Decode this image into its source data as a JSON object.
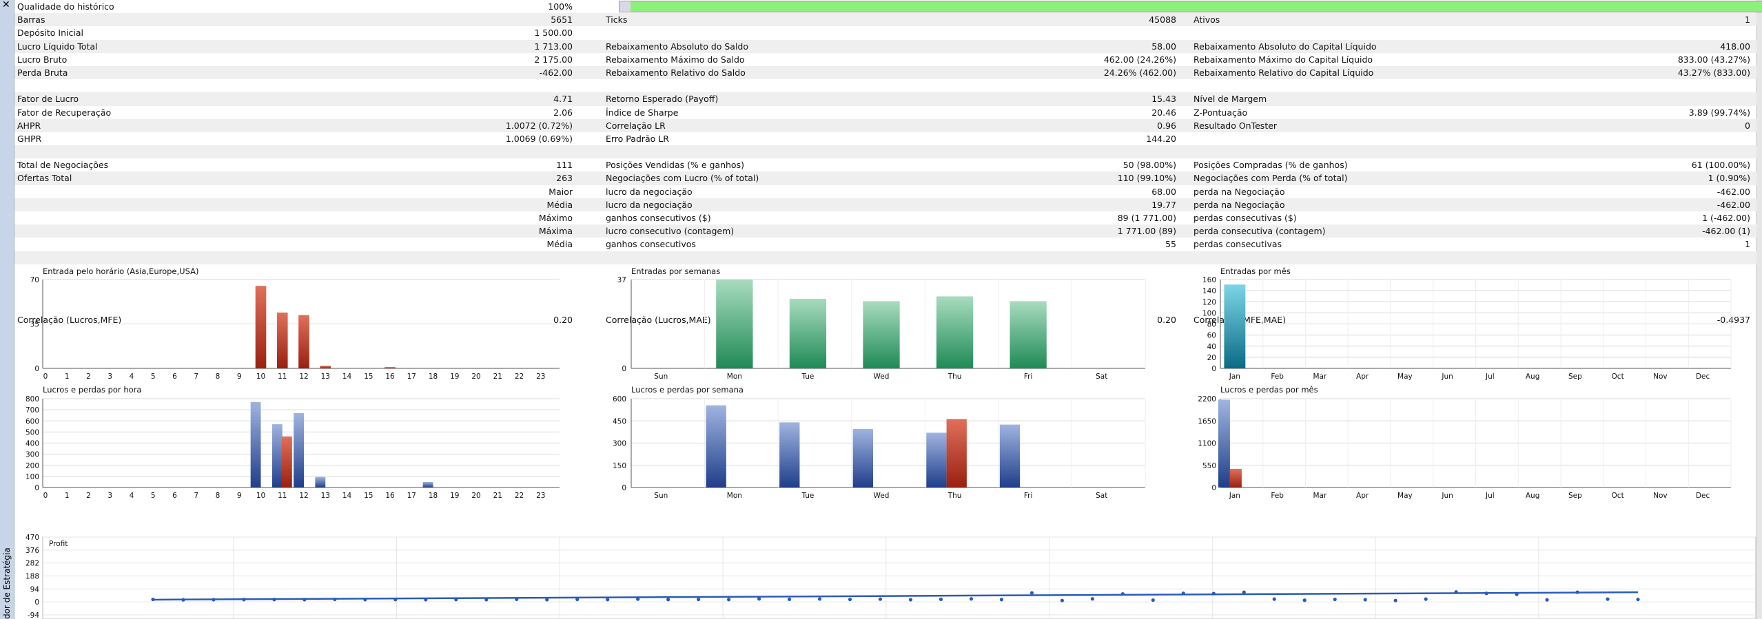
{
  "sidebar": {
    "close_glyph": "✕",
    "vertical_label": "dor de Estratégia"
  },
  "summary": {
    "quality_label": "Qualidade do histórico",
    "quality_value": "100%",
    "quality_fraction": 1.0,
    "rows": [
      {
        "shade": true,
        "c": [
          "Barras",
          "5651",
          "Ticks",
          "45088",
          "Ativos",
          "1"
        ]
      },
      {
        "shade": false,
        "c": [
          "Depósito Inicial",
          "1 500.00",
          "",
          "",
          "",
          ""
        ]
      },
      {
        "shade": true,
        "c": [
          "Lucro Líquido Total",
          "1 713.00",
          "Rebaixamento Absoluto do Saldo",
          "58.00",
          "Rebaixamento Absoluto do Capital Líquido",
          "418.00"
        ]
      },
      {
        "shade": false,
        "c": [
          "Lucro Bruto",
          "2 175.00",
          "Rebaixamento Máximo do Saldo",
          "462.00 (24.26%)",
          "Rebaixamento Máximo do Capital Líquido",
          "833.00 (43.27%)"
        ]
      },
      {
        "shade": true,
        "c": [
          "Perda Bruta",
          "-462.00",
          "Rebaixamento Relativo do Saldo",
          "24.26% (462.00)",
          "Rebaixamento Relativo do Capital Líquido",
          "43.27% (833.00)"
        ]
      },
      {
        "shade": false,
        "c": [
          "",
          "",
          "",
          "",
          "",
          ""
        ]
      },
      {
        "shade": true,
        "c": [
          "Fator de Lucro",
          "4.71",
          "Retorno Esperado (Payoff)",
          "15.43",
          "Nível de Margem",
          ""
        ]
      },
      {
        "shade": false,
        "c": [
          "Fator de Recuperação",
          "2.06",
          "Índice de Sharpe",
          "20.46",
          "Z-Pontuação",
          "3.89 (99.74%)"
        ]
      },
      {
        "shade": true,
        "c": [
          "AHPR",
          "1.0072 (0.72%)",
          "Correlação LR",
          "0.96",
          "Resultado OnTester",
          "0"
        ]
      },
      {
        "shade": false,
        "c": [
          "GHPR",
          "1.0069 (0.69%)",
          "Erro Padrão LR",
          "144.20",
          "",
          ""
        ]
      },
      {
        "shade": true,
        "c": [
          "",
          "",
          "",
          "",
          "",
          ""
        ]
      },
      {
        "shade": false,
        "c": [
          "Total de Negociações",
          "111",
          "Posições Vendidas (% e ganhos)",
          "50 (98.00%)",
          "Posições Compradas (% de ganhos)",
          "61 (100.00%)"
        ]
      },
      {
        "shade": true,
        "c": [
          "Ofertas Total",
          "263",
          "Negociações com Lucro (% of total)",
          "110 (99.10%)",
          "Negociações com Perda (% of total)",
          "1 (0.90%)"
        ]
      },
      {
        "shade": false,
        "r": "Maior",
        "c": [
          "",
          "",
          "lucro da negociação",
          "68.00",
          "perda na Negociação",
          "-462.00"
        ]
      },
      {
        "shade": true,
        "r": "Média",
        "c": [
          "",
          "",
          "lucro da negociação",
          "19.77",
          "perda na Negociação",
          "-462.00"
        ]
      },
      {
        "shade": false,
        "r": "Máximo",
        "c": [
          "",
          "",
          "ganhos consecutivos ($)",
          "89 (1 771.00)",
          "perdas consecutivas ($)",
          "1 (-462.00)"
        ]
      },
      {
        "shade": true,
        "r": "Máxima",
        "c": [
          "",
          "",
          "lucro consecutivo (contagem)",
          "1 771.00 (89)",
          "perda consecutiva (contagem)",
          "-462.00 (1)"
        ]
      },
      {
        "shade": false,
        "r": "Média",
        "c": [
          "",
          "",
          "ganhos consecutivos",
          "55",
          "perdas consecutivas",
          "1"
        ]
      },
      {
        "shade": true,
        "c": [
          "",
          "",
          "",
          "",
          "",
          ""
        ]
      }
    ]
  },
  "correlation_row": {
    "labels": [
      "Correlação (Lucros,MFE)",
      "Correlação (Lucros,MAE)",
      "Correlação(MFE,MAE)"
    ],
    "values": [
      "0.20",
      "0.20",
      "-0.4937"
    ]
  },
  "colors": {
    "red_bar_top": "#e0705a",
    "red_bar_bottom": "#9a2010",
    "green_bar_top": "#a8dcbf",
    "green_bar_bottom": "#1f8a55",
    "teal_bar_top": "#7cd6e6",
    "teal_bar_bottom": "#0a6a85",
    "blue_bar_top": "#a0b4e0",
    "blue_bar_bottom": "#1f3e8a",
    "line_blue": "#2a5bb8",
    "gridline": "#d8d8d8"
  },
  "chart_data": [
    {
      "type": "bar",
      "title": "Entrada pelo horário (Asia,Europe,USA)",
      "categories": [
        "0",
        "1",
        "2",
        "3",
        "4",
        "5",
        "6",
        "7",
        "8",
        "9",
        "10",
        "11",
        "12",
        "13",
        "14",
        "15",
        "16",
        "17",
        "18",
        "19",
        "20",
        "21",
        "22",
        "23"
      ],
      "yticks": [
        "0",
        "35",
        "70"
      ],
      "ylim": [
        0,
        70
      ],
      "series": [
        {
          "values": [
            0,
            0,
            0,
            0,
            0,
            0,
            0,
            0,
            0,
            0,
            65,
            44,
            42,
            2,
            0,
            0,
            1,
            0,
            0,
            0,
            0,
            0,
            0,
            0
          ]
        }
      ]
    },
    {
      "type": "bar",
      "title": "Entradas por semanas",
      "categories": [
        "Sun",
        "Mon",
        "Tue",
        "Wed",
        "Thu",
        "Fri",
        "Sat"
      ],
      "yticks": [
        "0",
        "37"
      ],
      "ylim": [
        0,
        37
      ],
      "series": [
        {
          "values": [
            0,
            37,
            29,
            28,
            30,
            28,
            0
          ]
        }
      ]
    },
    {
      "type": "bar",
      "title": "Entradas por mês",
      "categories": [
        "Jan",
        "Feb",
        "Mar",
        "Apr",
        "May",
        "Jun",
        "Jul",
        "Aug",
        "Sep",
        "Oct",
        "Nov",
        "Dec"
      ],
      "yticks": [
        "0",
        "20",
        "40",
        "60",
        "80",
        "100",
        "120",
        "140",
        "160"
      ],
      "ylim": [
        0,
        160
      ],
      "series": [
        {
          "values": [
            151,
            0,
            0,
            0,
            0,
            0,
            0,
            0,
            0,
            0,
            0,
            0
          ]
        }
      ]
    },
    {
      "type": "bar",
      "title": "Lucros e perdas por hora",
      "categories": [
        "0",
        "1",
        "2",
        "3",
        "4",
        "5",
        "6",
        "7",
        "8",
        "9",
        "10",
        "11",
        "12",
        "13",
        "14",
        "15",
        "16",
        "17",
        "18",
        "19",
        "20",
        "21",
        "22",
        "23"
      ],
      "yticks": [
        "0",
        "100",
        "200",
        "300",
        "400",
        "500",
        "600",
        "700",
        "800"
      ],
      "ylim": [
        0,
        800
      ],
      "series": [
        {
          "values": [
            0,
            0,
            0,
            0,
            0,
            0,
            0,
            0,
            0,
            0,
            770,
            570,
            670,
            95,
            0,
            0,
            0,
            0,
            50,
            0,
            0,
            0,
            0,
            0
          ]
        },
        {
          "values": [
            0,
            0,
            0,
            0,
            0,
            0,
            0,
            0,
            0,
            0,
            0,
            460,
            0,
            0,
            0,
            0,
            0,
            0,
            0,
            0,
            0,
            0,
            0,
            0
          ]
        }
      ]
    },
    {
      "type": "bar",
      "title": "Lucros e perdas por semana",
      "categories": [
        "Sun",
        "Mon",
        "Tue",
        "Wed",
        "Thu",
        "Fri",
        "Sat"
      ],
      "yticks": [
        "0",
        "150",
        "300",
        "450",
        "600"
      ],
      "ylim": [
        0,
        600
      ],
      "series": [
        {
          "values": [
            0,
            555,
            440,
            395,
            370,
            425,
            0
          ]
        },
        {
          "values": [
            0,
            0,
            0,
            0,
            462,
            0,
            0
          ]
        }
      ]
    },
    {
      "type": "bar",
      "title": "Lucros e perdas por mês",
      "categories": [
        "Jan",
        "Feb",
        "Mar",
        "Apr",
        "May",
        "Jun",
        "Jul",
        "Aug",
        "Sep",
        "Oct",
        "Nov",
        "Dec"
      ],
      "yticks": [
        "0",
        "550",
        "1100",
        "1650",
        "2200"
      ],
      "ylim": [
        0,
        2200
      ],
      "series": [
        {
          "values": [
            2175,
            0,
            0,
            0,
            0,
            0,
            0,
            0,
            0,
            0,
            0,
            0
          ]
        },
        {
          "values": [
            462,
            0,
            0,
            0,
            0,
            0,
            0,
            0,
            0,
            0,
            0,
            0
          ]
        }
      ]
    },
    {
      "type": "scatter",
      "title": "Profit",
      "yticks": [
        "470",
        "376",
        "282",
        "188",
        "94",
        "0",
        "-94"
      ],
      "ylim": [
        -94,
        470
      ],
      "x": [
        1,
        2,
        3,
        4,
        5,
        6,
        7,
        8,
        9,
        10,
        11,
        12,
        13,
        14,
        15,
        16,
        17,
        18,
        19,
        20,
        21,
        22,
        23,
        24,
        25,
        26,
        27,
        28,
        29,
        30,
        31,
        32,
        33,
        34,
        35,
        36,
        37,
        38,
        39,
        40,
        41,
        42,
        43,
        44,
        45,
        46,
        47,
        48,
        49,
        50
      ],
      "y": [
        18,
        15,
        16,
        17,
        17,
        16,
        18,
        17,
        17,
        16,
        17,
        16,
        19,
        16,
        18,
        17,
        20,
        17,
        18,
        17,
        22,
        19,
        21,
        18,
        20,
        16,
        19,
        22,
        17,
        65,
        10,
        22,
        58,
        13,
        62,
        60,
        70,
        20,
        12,
        18,
        16,
        10,
        20,
        72,
        62,
        55,
        15,
        70,
        20,
        18
      ],
      "trend": [
        [
          1,
          16
        ],
        [
          50,
          70
        ]
      ]
    }
  ]
}
